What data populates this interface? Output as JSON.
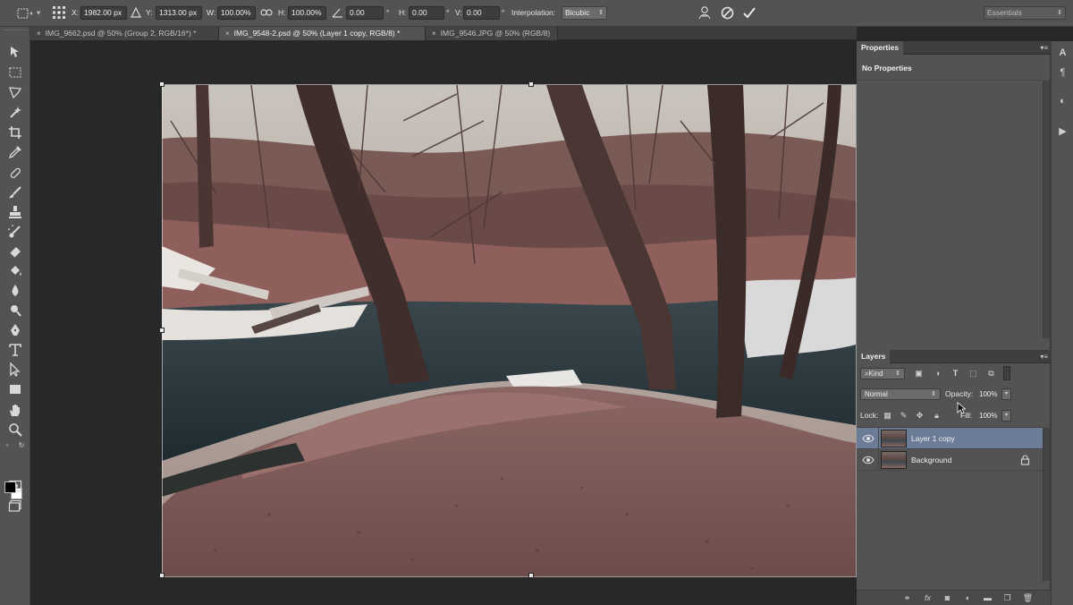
{
  "options_bar": {
    "x_label": "X:",
    "x_value": "1982.00 px",
    "y_label": "Y:",
    "y_value": "1313.00 px",
    "w_label": "W:",
    "w_value": "100.00%",
    "h_label": "H:",
    "h_value": "100.00%",
    "angle_value": "0.00",
    "angle_unit": "°",
    "hskew_label": "H:",
    "hskew_value": "0.00",
    "hskew_unit": "°",
    "vskew_label": "V:",
    "vskew_value": "0.00",
    "vskew_unit": "°",
    "interpolation_label": "Interpolation:",
    "interpolation_value": "Bicubic",
    "workspace_value": "Essentials"
  },
  "tabs": [
    {
      "label": "IMG_9662.psd @ 50% (Group 2, RGB/16*) *",
      "close": "×"
    },
    {
      "label": "IMG_9548-2.psd @ 50% (Layer 1 copy, RGB/8) *",
      "close": "×"
    },
    {
      "label": "IMG_9546.JPG @ 50% (RGB/8)",
      "close": "×"
    }
  ],
  "properties": {
    "title": "Properties",
    "empty_text": "No Properties",
    "menu": "▾≡"
  },
  "layers": {
    "title": "Layers",
    "menu": "▾≡",
    "filter_kind": "Kind",
    "blend_mode": "Normal",
    "opacity_label": "Opacity:",
    "opacity_value": "100%",
    "lock_label": "Lock:",
    "fill_label": "Fill:",
    "fill_value": "100%",
    "items": [
      {
        "name": "Layer 1 copy",
        "selected": true,
        "locked": false
      },
      {
        "name": "Background",
        "selected": false,
        "locked": true
      }
    ]
  },
  "colors": {
    "foreground": "#000000",
    "background": "#ffffff",
    "selection": "#6c7c96"
  }
}
